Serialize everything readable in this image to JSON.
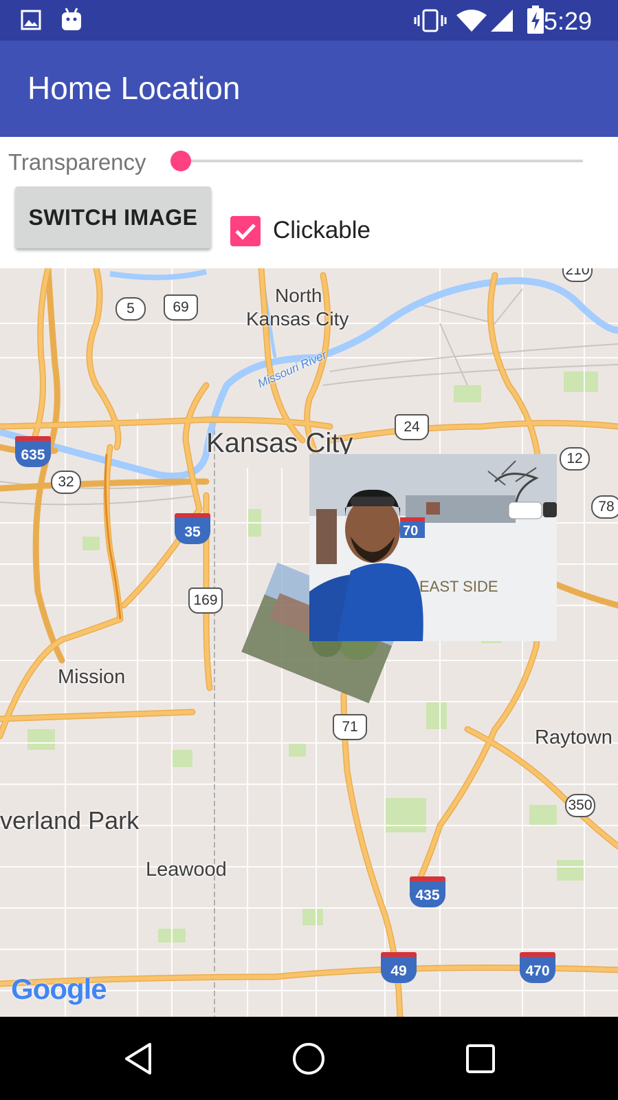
{
  "status_bar": {
    "time": "5:29",
    "left_icons": [
      "image-icon",
      "android-icon"
    ],
    "right_icons": [
      "vibrate-icon",
      "wifi-icon",
      "signal-icon",
      "battery-charging-icon"
    ]
  },
  "app_bar": {
    "title": "Home Location"
  },
  "controls": {
    "transparency_label": "Transparency",
    "transparency_value": 0,
    "switch_image_label": "SWITCH IMAGE",
    "clickable_label": "Clickable",
    "clickable_checked": true
  },
  "map": {
    "place_labels": {
      "north_kansas_city_1": "North",
      "north_kansas_city_2": "Kansas City",
      "missouri_river": "Missouri River",
      "kansas_city": "Kansas City",
      "mission": "Mission",
      "overland_park": "verland Park",
      "leawood": "Leawood",
      "raytown": "Raytown",
      "east_side": "EAST SIDE"
    },
    "shields": {
      "us_69": "69",
      "sr_5": "5",
      "us_24": "24",
      "i_635": "635",
      "sr_32": "32",
      "i_35": "35",
      "us_169": "169",
      "i_70": "70",
      "sr_12": "12",
      "sr_78": "78",
      "sr_210": "210",
      "us_71": "71",
      "sr_350": "350",
      "i_435": "435",
      "i_49": "49",
      "i_470": "470"
    },
    "google_logo": "Google",
    "colors": {
      "land": "#ece6e3",
      "highway": "#f9c36b",
      "water": "#a3ccff",
      "park": "#cde5b0"
    }
  },
  "nav_bar": {
    "buttons": [
      "back-icon",
      "home-icon",
      "recents-icon"
    ]
  }
}
